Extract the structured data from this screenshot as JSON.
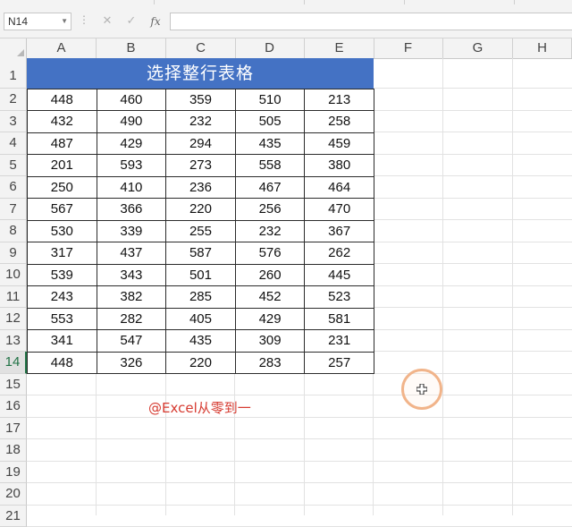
{
  "name_box": {
    "value": "N14"
  },
  "formula_bar": {
    "cancel_icon": "✕",
    "confirm_icon": "✓",
    "fx_label": "fx",
    "value": ""
  },
  "columns": [
    "A",
    "B",
    "C",
    "D",
    "E",
    "F",
    "G",
    "H"
  ],
  "rows": [
    "1",
    "2",
    "3",
    "4",
    "5",
    "6",
    "7",
    "8",
    "9",
    "10",
    "11",
    "12",
    "13",
    "14",
    "15",
    "16",
    "17",
    "18",
    "19",
    "20",
    "21"
  ],
  "selected_row": "14",
  "sheet": {
    "title": "选择整行表格",
    "title_color": "#4472c4",
    "data": [
      [
        "448",
        "460",
        "359",
        "510",
        "213"
      ],
      [
        "432",
        "490",
        "232",
        "505",
        "258"
      ],
      [
        "487",
        "429",
        "294",
        "435",
        "459"
      ],
      [
        "201",
        "593",
        "273",
        "558",
        "380"
      ],
      [
        "250",
        "410",
        "236",
        "467",
        "464"
      ],
      [
        "567",
        "366",
        "220",
        "256",
        "470"
      ],
      [
        "530",
        "339",
        "255",
        "232",
        "367"
      ],
      [
        "317",
        "437",
        "587",
        "576",
        "262"
      ],
      [
        "539",
        "343",
        "501",
        "260",
        "445"
      ],
      [
        "243",
        "382",
        "285",
        "452",
        "523"
      ],
      [
        "553",
        "282",
        "405",
        "429",
        "581"
      ],
      [
        "341",
        "547",
        "435",
        "309",
        "231"
      ],
      [
        "448",
        "326",
        "220",
        "283",
        "257"
      ]
    ]
  },
  "watermark": "@Excel从零到一",
  "watermark_color": "#d63a30",
  "icons": {
    "cursor": "cell-select-cross-icon"
  }
}
